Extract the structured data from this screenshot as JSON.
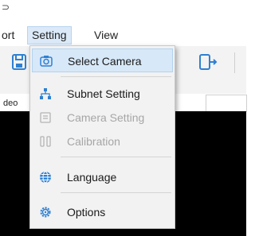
{
  "window": {
    "title_fragment": "⊃"
  },
  "menubar": {
    "items": [
      "ort",
      "Setting",
      "View"
    ]
  },
  "tabs": {
    "active_fragment": "deo"
  },
  "colors": {
    "accent": "#2f80d1",
    "menu_highlight": "#d7e8f8",
    "disabled_text": "#a6a6a6",
    "video_bg": "#000000"
  },
  "setting_menu": {
    "items": [
      {
        "label": "Select Camera",
        "icon": "camera-icon",
        "enabled": true,
        "highlighted": true
      },
      {
        "label": "Subnet Setting",
        "icon": "network-icon",
        "enabled": true
      },
      {
        "label": "Camera Setting",
        "icon": "camera-settings-icon",
        "enabled": false
      },
      {
        "label": "Calibration",
        "icon": "calibration-icon",
        "enabled": false
      },
      {
        "label": "Language",
        "icon": "globe-icon",
        "enabled": true
      },
      {
        "label": "Options",
        "icon": "gear-icon",
        "enabled": true
      }
    ]
  }
}
